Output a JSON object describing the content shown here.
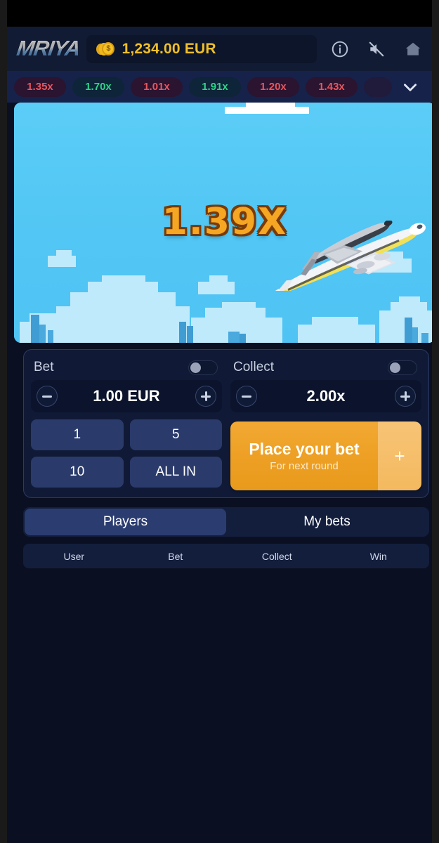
{
  "app": {
    "logo_text": "MRIYA",
    "balance": "1,234.00 EUR",
    "coin_symbol": "$"
  },
  "header": {
    "info_icon": "info-icon",
    "sound_icon": "sound-muted-icon",
    "home_icon": "home-icon"
  },
  "history": {
    "expand_icon": "chevron-down-icon",
    "chips": [
      {
        "value": "1.35x",
        "color": "red"
      },
      {
        "value": "1.70x",
        "color": "green"
      },
      {
        "value": "1.01x",
        "color": "red"
      },
      {
        "value": "1.91x",
        "color": "green"
      },
      {
        "value": "1.20x",
        "color": "red"
      },
      {
        "value": "1.43x",
        "color": "red"
      }
    ]
  },
  "game": {
    "multiplier": "1.39X",
    "plane_icon": "airplane-with-shuttle-icon"
  },
  "bet_panel": {
    "bet": {
      "label": "Bet",
      "toggle_state": "off",
      "value": "1.00 EUR",
      "minus_label": "−",
      "plus_label": "+"
    },
    "collect": {
      "label": "Collect",
      "toggle_state": "off",
      "value": "2.00x",
      "minus_label": "−",
      "plus_label": "+"
    },
    "quick_bets": [
      "1",
      "5",
      "10",
      "ALL IN"
    ],
    "place_bet": {
      "title": "Place your bet",
      "subtitle": "For next round",
      "plus_label": "+"
    }
  },
  "list_section": {
    "tabs": [
      {
        "label": "Players",
        "active": true
      },
      {
        "label": "My bets",
        "active": false
      }
    ],
    "columns": [
      "User",
      "Bet",
      "Collect",
      "Win"
    ],
    "rows": []
  },
  "colors": {
    "accent_orange": "#eda024",
    "balance_gold": "#f0c02a",
    "win_green": "#2fd38a",
    "loss_red": "#e8565f",
    "panel_navy": "#101a36",
    "page_bg": "#0a1022",
    "sky_blue": "#52c6f4"
  }
}
